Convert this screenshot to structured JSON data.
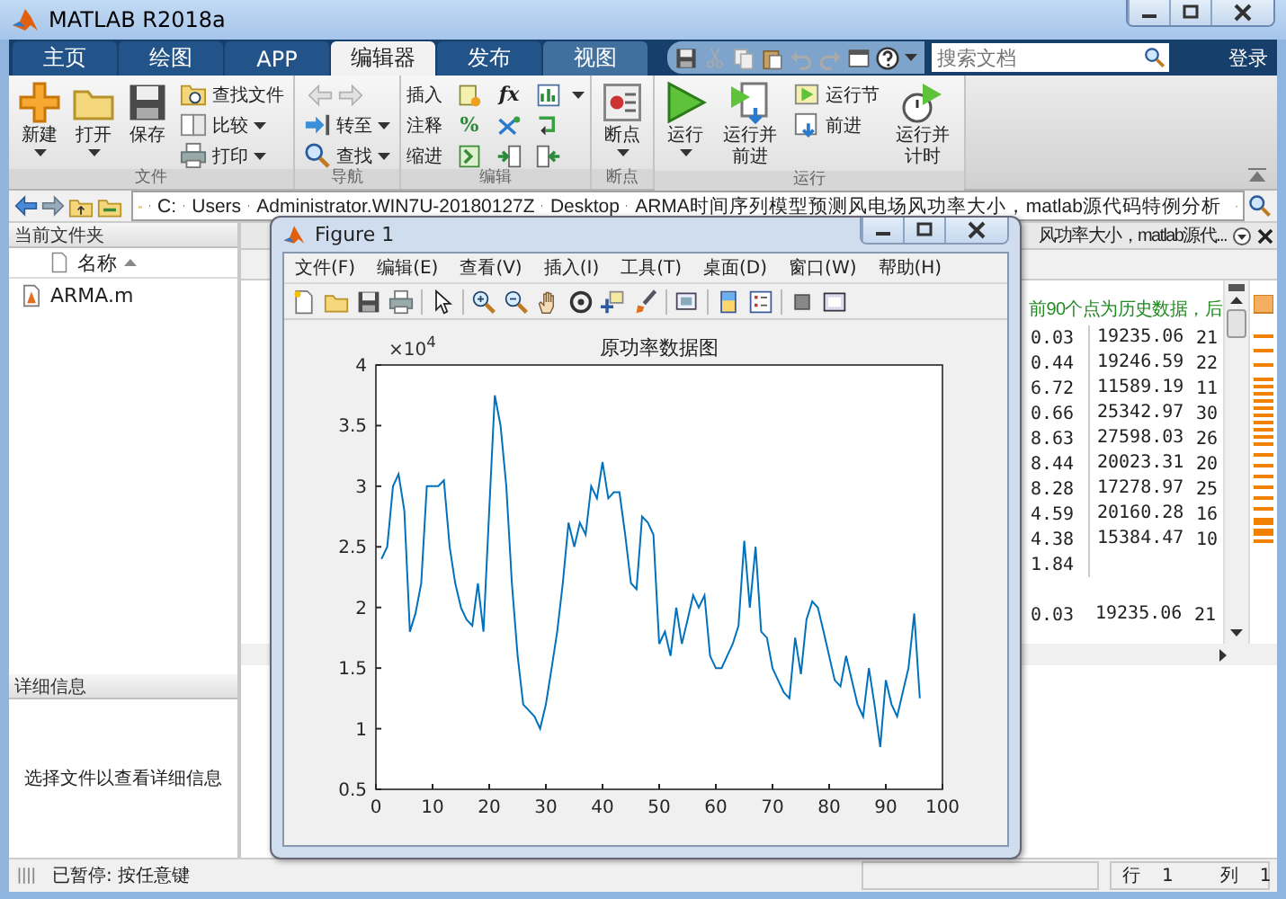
{
  "window": {
    "title": "MATLAB R2018a"
  },
  "tabs": [
    {
      "label": "主页",
      "selected": false
    },
    {
      "label": "绘图",
      "selected": false
    },
    {
      "label": "APP",
      "selected": false
    },
    {
      "label": "编辑器",
      "selected": true
    },
    {
      "label": "发布",
      "selected": false
    },
    {
      "label": "视图",
      "selected": false
    }
  ],
  "search": {
    "placeholder": "搜索文档"
  },
  "login_button": "登录",
  "toolstrip": [
    {
      "title": "文件",
      "items": [
        {
          "kind": "large",
          "label": "新建",
          "menu": true
        },
        {
          "kind": "large",
          "label": "打开",
          "menu": true
        },
        {
          "kind": "large",
          "label": "保存",
          "menu": false
        },
        {
          "kind": "stack",
          "rows": [
            {
              "kind": "button",
              "label": "查找文件",
              "menu": false
            },
            {
              "kind": "button",
              "label": "比较",
              "menu": true
            },
            {
              "kind": "button",
              "label": "打印",
              "menu": true
            }
          ]
        }
      ]
    },
    {
      "title": "导航",
      "items": [
        {
          "kind": "stack",
          "rows": [
            {
              "kind": "arrows"
            },
            {
              "kind": "button",
              "label": "转至",
              "menu": true
            },
            {
              "kind": "button",
              "label": "查找",
              "menu": true
            }
          ]
        }
      ]
    },
    {
      "title": "编辑",
      "items": [
        {
          "kind": "grid",
          "rows": [
            {
              "label": "插入",
              "menu": true,
              "tools": [
                {
                  "kind": "icon"
                },
                {
                  "kind": "symbol",
                  "text": "fx"
                },
                {
                  "kind": "icon"
                }
              ]
            },
            {
              "label": "注释",
              "menu": false,
              "tools": [
                {
                  "kind": "symbol",
                  "text": "%"
                },
                {
                  "kind": "icon"
                },
                {
                  "kind": "icon"
                }
              ]
            },
            {
              "label": "缩进",
              "menu": false,
              "tools": [
                {
                  "kind": "icon"
                },
                {
                  "kind": "icon"
                },
                {
                  "kind": "icon"
                }
              ]
            }
          ]
        }
      ]
    },
    {
      "title": "断点",
      "items": [
        {
          "kind": "large",
          "label": "断点",
          "menu": true
        }
      ]
    },
    {
      "title": "运行",
      "items": [
        {
          "kind": "large",
          "label": "运行",
          "menu": true
        },
        {
          "kind": "large",
          "label": "运行并前进",
          "menu": false
        },
        {
          "kind": "stack",
          "rows": [
            {
              "kind": "button",
              "label": "运行节",
              "menu": false
            },
            {
              "kind": "button",
              "label": "前进",
              "menu": false
            }
          ]
        },
        {
          "kind": "large",
          "label": "运行并计时",
          "menu": false
        }
      ]
    }
  ],
  "address_bar": {
    "path": [
      "C:",
      "Users",
      "Administrator.WIN7U-20180127Z",
      "Desktop",
      "ARMA时间序列模型预测风电场风功率大小，matlab源代码特例分析"
    ]
  },
  "current_folder": {
    "title": "当前文件夹",
    "column": "名称",
    "files": [
      "ARMA.m"
    ],
    "details_title": "详细信息",
    "details_message": "选择文件以查看详细信息"
  },
  "editor": {
    "tab_title": "风功率大小，matlab源代...",
    "comment": "前90个点为历史数据，后",
    "rows": [
      [
        "0.03",
        "19235.06",
        "21"
      ],
      [
        "0.44",
        "19246.59",
        "22"
      ],
      [
        "6.72",
        "11589.19",
        "11"
      ],
      [
        "0.66",
        "25342.97",
        "30"
      ],
      [
        "8.63",
        "27598.03",
        "26"
      ],
      [
        "8.44",
        "20023.31",
        "20"
      ],
      [
        "8.28",
        "17278.97",
        "25"
      ],
      [
        "4.59",
        "20160.28",
        "16"
      ],
      [
        "4.38",
        "15384.47",
        "10"
      ],
      [
        "1.84"
      ]
    ],
    "rows_below": [
      [
        "0.03",
        "19235.06",
        "21"
      ]
    ]
  },
  "figure": {
    "title": "Figure 1",
    "menu": [
      "文件(F)",
      "编辑(E)",
      "查看(V)",
      "插入(I)",
      "工具(T)",
      "桌面(D)",
      "窗口(W)",
      "帮助(H)"
    ],
    "axis_multiplier": "×10$^{4}$",
    "chart_data": {
      "type": "line",
      "title": "原功率数据图",
      "x": [
        1,
        2,
        3,
        4,
        5,
        6,
        7,
        8,
        9,
        10,
        11,
        12,
        13,
        14,
        15,
        16,
        17,
        18,
        19,
        20,
        21,
        22,
        23,
        24,
        25,
        26,
        27,
        28,
        29,
        30,
        31,
        32,
        33,
        34,
        35,
        36,
        37,
        38,
        39,
        40,
        41,
        42,
        43,
        44,
        45,
        46,
        47,
        48,
        49,
        50,
        51,
        52,
        53,
        54,
        55,
        56,
        57,
        58,
        59,
        60,
        61,
        62,
        63,
        64,
        65,
        66,
        67,
        68,
        69,
        70,
        71,
        72,
        73,
        74,
        75,
        76,
        77,
        78,
        79,
        80,
        81,
        82,
        83,
        84,
        85,
        86,
        87,
        88,
        89,
        90,
        91,
        92,
        93,
        94,
        95,
        96
      ],
      "xlim": [
        0,
        100
      ],
      "ylim": [
        0.5,
        4
      ],
      "xticks": [
        0,
        10,
        20,
        30,
        40,
        50,
        60,
        70,
        80,
        90,
        100
      ],
      "yticks": [
        0.5,
        1,
        1.5,
        2,
        2.5,
        3,
        3.5,
        4
      ],
      "series": [
        {
          "color": "#0072bd",
          "values": [
            2.4,
            2.5,
            3.0,
            3.1,
            2.8,
            1.8,
            1.95,
            2.2,
            3.0,
            3.0,
            3.0,
            3.05,
            2.5,
            2.2,
            2.0,
            1.9,
            1.85,
            2.2,
            1.8,
            2.8,
            3.75,
            3.5,
            3.0,
            2.2,
            1.6,
            1.2,
            1.15,
            1.1,
            1.0,
            1.2,
            1.5,
            1.8,
            2.2,
            2.7,
            2.5,
            2.7,
            2.6,
            3.0,
            2.9,
            3.2,
            2.9,
            2.95,
            2.95,
            2.6,
            2.2,
            2.15,
            2.75,
            2.7,
            2.6,
            1.7,
            1.8,
            1.6,
            2.0,
            1.7,
            1.9,
            2.1,
            2.0,
            2.1,
            1.6,
            1.5,
            1.5,
            1.6,
            1.7,
            1.85,
            2.55,
            2.0,
            2.5,
            1.8,
            1.75,
            1.5,
            1.4,
            1.3,
            1.25,
            1.75,
            1.45,
            1.9,
            2.05,
            2.0,
            1.8,
            1.6,
            1.4,
            1.35,
            1.6,
            1.4,
            1.2,
            1.1,
            1.5,
            1.2,
            0.85,
            1.4,
            1.2,
            1.1,
            1.3,
            1.5,
            1.95,
            1.25
          ]
        }
      ]
    }
  },
  "status_bar": {
    "message": "已暂停: 按任意键",
    "row_label": "行",
    "row": "1",
    "column_label": "列",
    "column": "1"
  }
}
